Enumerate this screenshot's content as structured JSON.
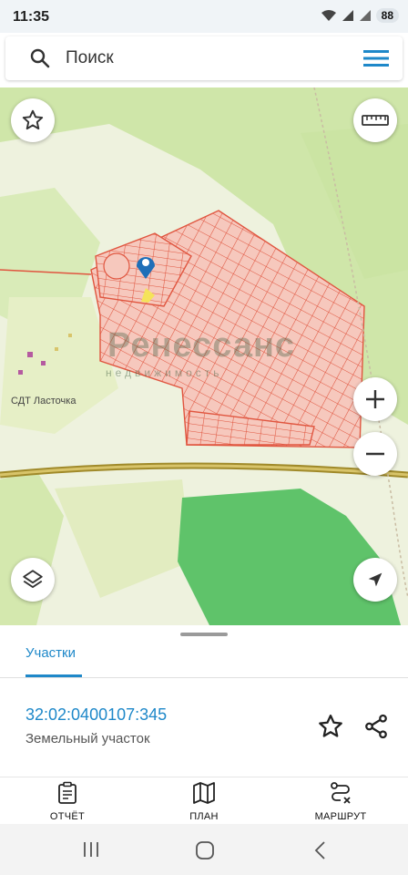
{
  "status_bar": {
    "time": "11:35",
    "battery": "88"
  },
  "search": {
    "placeholder": "Поиск"
  },
  "map": {
    "place_label": "СДТ Ласточка",
    "watermark_title": "Ренессанс",
    "watermark_subtitle": "недвижимость"
  },
  "sheet": {
    "tab_label": "Участки",
    "cadastral_number": "32:02:0400107:345",
    "parcel_type": "Земельный участок"
  },
  "bottom_nav": {
    "items": [
      {
        "label": "ОТЧЁТ",
        "icon": "report-icon"
      },
      {
        "label": "ПЛАН",
        "icon": "map-plan-icon"
      },
      {
        "label": "МАРШРУТ",
        "icon": "route-icon"
      }
    ]
  },
  "colors": {
    "accent": "#1e88c9",
    "parcel_fill": "#f7c9be",
    "parcel_stroke": "#e0553f",
    "forest": "#cfe6a9",
    "dark_forest": "#5fc36a",
    "road": "#a08a2a"
  }
}
